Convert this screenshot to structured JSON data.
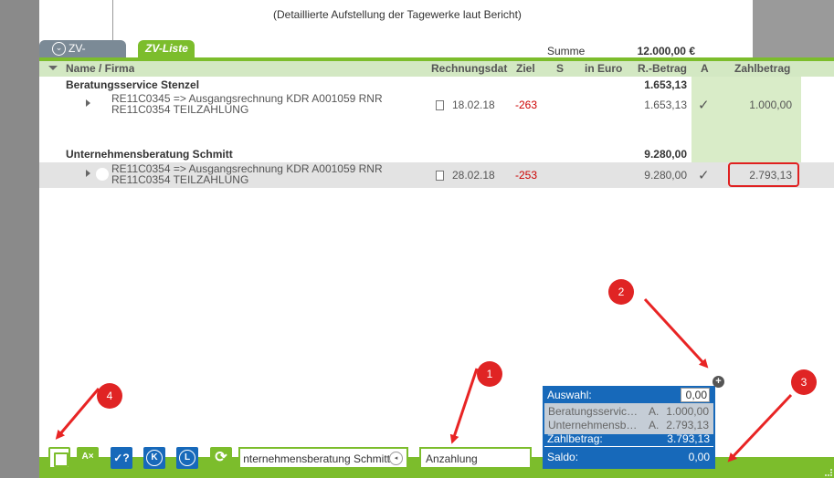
{
  "document": {
    "line": "(Detaillierte Aufstellung der Tagewerke laut Bericht)"
  },
  "tabs": {
    "sammler": "ZV-Sammler",
    "liste": "ZV-Liste"
  },
  "summary": {
    "summe_label": "Summe",
    "summe_value": "12.000,00 €"
  },
  "columns": {
    "name": "Name / Firma",
    "rechnungsdatum": "Rechnungsdatu",
    "ziel": "Ziel",
    "s": "S",
    "in_euro": "in Euro",
    "r_betrag": "R.-Betrag",
    "a": "A",
    "zahlbetrag": "Zahlbetrag"
  },
  "groups": [
    {
      "name": "Beratungsservice Stenzel",
      "sum": "1.653,13",
      "rows": [
        {
          "desc_line1": "RE11C0345 =>  Ausgangsrechnung KDR A001059 RNR",
          "desc_line2": "RE11C0354 TEILZAHLUNG",
          "date": "18.02.18",
          "ziel": "-263",
          "betrag": "1.653,13",
          "check": "✓",
          "zahlbetrag": "1.000,00"
        }
      ]
    },
    {
      "name": "Unternehmensberatung Schmitt",
      "sum": "9.280,00",
      "rows": [
        {
          "desc_line1": "RE11C0354 =>  Ausgangsrechnung KDR A001059 RNR",
          "desc_line2": "RE11C0354 TEILZAHLUNG",
          "date": "28.02.18",
          "ziel": "-253",
          "betrag": "9.280,00",
          "check": "✓",
          "zahlbetrag": "2.793,13"
        }
      ]
    }
  ],
  "toolbar": {
    "clear_label": "A×",
    "query_label": "✓?",
    "k_label": "K",
    "l_label": "L",
    "refresh_label": "⟳",
    "company_value": "Unternehmensberatung Schmitt",
    "company_btn": "◂",
    "payment_type_value": "Anzahlung"
  },
  "panel": {
    "auswahl_label": "Auswahl:",
    "auswahl_value": "0,00",
    "items": [
      {
        "name": "Beratungsservice Stenzel",
        "a": "A.",
        "value": "1.000,00"
      },
      {
        "name": "Unternehmensberatung Schmitt",
        "a": "A.",
        "value": "2.793,13"
      }
    ],
    "zahlbetrag_label": "Zahlbetrag:",
    "zahlbetrag_value": "3.793,13",
    "saldo_label": "Saldo:",
    "saldo_value": "0,00",
    "plus": "+"
  },
  "markers": [
    "1",
    "2",
    "3",
    "4"
  ],
  "colors": {
    "accent_green": "#7cbd2c",
    "header_green": "#d3e8c3",
    "panel_blue": "#1769ba",
    "marker_red": "#e02424",
    "negative_red": "#cc0000"
  },
  "icons": [
    "chevron-circle-icon",
    "caret-icon",
    "document-icon",
    "check-icon",
    "save-icon",
    "clear-format-icon",
    "query-icon",
    "k-circle-icon",
    "l-circle-icon",
    "refresh-icon",
    "plus-icon"
  ]
}
